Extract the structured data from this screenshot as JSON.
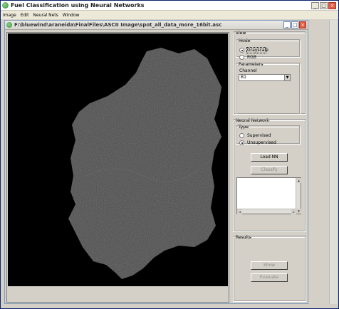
{
  "app": {
    "title": "Fuel Classification using Neural Networks",
    "window_controls": [
      "_",
      "□",
      "×"
    ]
  },
  "menu": [
    "Image",
    "Edit",
    "Neural Nets",
    "Window"
  ],
  "child": {
    "title": "F:\\bluewind\\araneida\\FinalFiles\\ASCII Image\\spot_all_data_more_16bit.asc",
    "window_controls": [
      "_",
      "□",
      "×"
    ]
  },
  "view": {
    "legend": "View",
    "mode_legend": "Mode",
    "grayscale_label": "Grayscale",
    "rgb_label": "RGB",
    "selected_mode": "Grayscale"
  },
  "parameters": {
    "legend": "Parameters",
    "channel_label": "Channel",
    "channel_value": "B1"
  },
  "neural": {
    "legend": "Neural Network",
    "type_legend": "Type",
    "supervised_label": "Supervised",
    "unsupervised_label": "Unsupervised",
    "selected_type": "Unsupervised",
    "load_label": "Load NN",
    "classify_label": "Classify"
  },
  "results": {
    "legend": "Results",
    "show_label": "Show",
    "evaluate_label": "Evaluate"
  },
  "icons": {
    "app_icon": "globe-icon",
    "dropdown": "chevron-down-icon"
  }
}
